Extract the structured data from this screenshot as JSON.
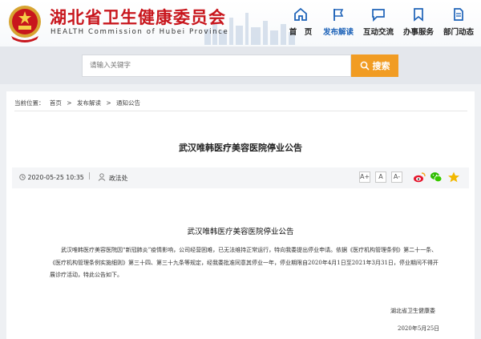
{
  "header": {
    "site_title": "湖北省卫生健康委员会",
    "site_subtitle": "HEALTH Commission of Hubei Province",
    "nav": [
      {
        "label": "首　页",
        "icon": "home-icon"
      },
      {
        "label": "发布解读",
        "icon": "flag-icon"
      },
      {
        "label": "互动交流",
        "icon": "chat-icon"
      },
      {
        "label": "办事服务",
        "icon": "bookmark-icon"
      },
      {
        "label": "部门动态",
        "icon": "document-icon"
      }
    ],
    "active_nav": "发布解读"
  },
  "search": {
    "placeholder": "请输入关键字",
    "button_label": "搜索"
  },
  "breadcrumb": {
    "prefix": "当前位置：",
    "items": [
      "首页",
      "发布解读",
      "通知公告"
    ],
    "separator": ">"
  },
  "article": {
    "title": "武汉唯韩医疗美容医院停业公告",
    "datetime": "2020-05-25 10:35",
    "org": "政法处",
    "font_sizes": [
      "A+",
      "A",
      "A-"
    ],
    "share": [
      "weibo-icon",
      "wechat-icon",
      "favorite-icon"
    ]
  },
  "document": {
    "title": "武汉唯韩医疗美容医院停业公告",
    "body": "武汉唯韩医疗美容医院因“新冠肺炎”疫情影响，公司经营困难，已无法维持正常运行，特向我委提出停业申请。依据《医疗机构管理条例》第二十一条、《医疗机构管理条例实施细则》第三十四、第三十九条等规定，经我委批准同意其停业一年，停业期限自2020年4月1日至2021年3月31日，停业期间不得开展诊疗活动，特此公告如下。",
    "signature": "湖北省卫生健康委",
    "date": "2020年5月25日"
  },
  "colors": {
    "brand_red": "#c8161d",
    "nav_active": "#1e63b8",
    "search_button": "#f19c23"
  }
}
